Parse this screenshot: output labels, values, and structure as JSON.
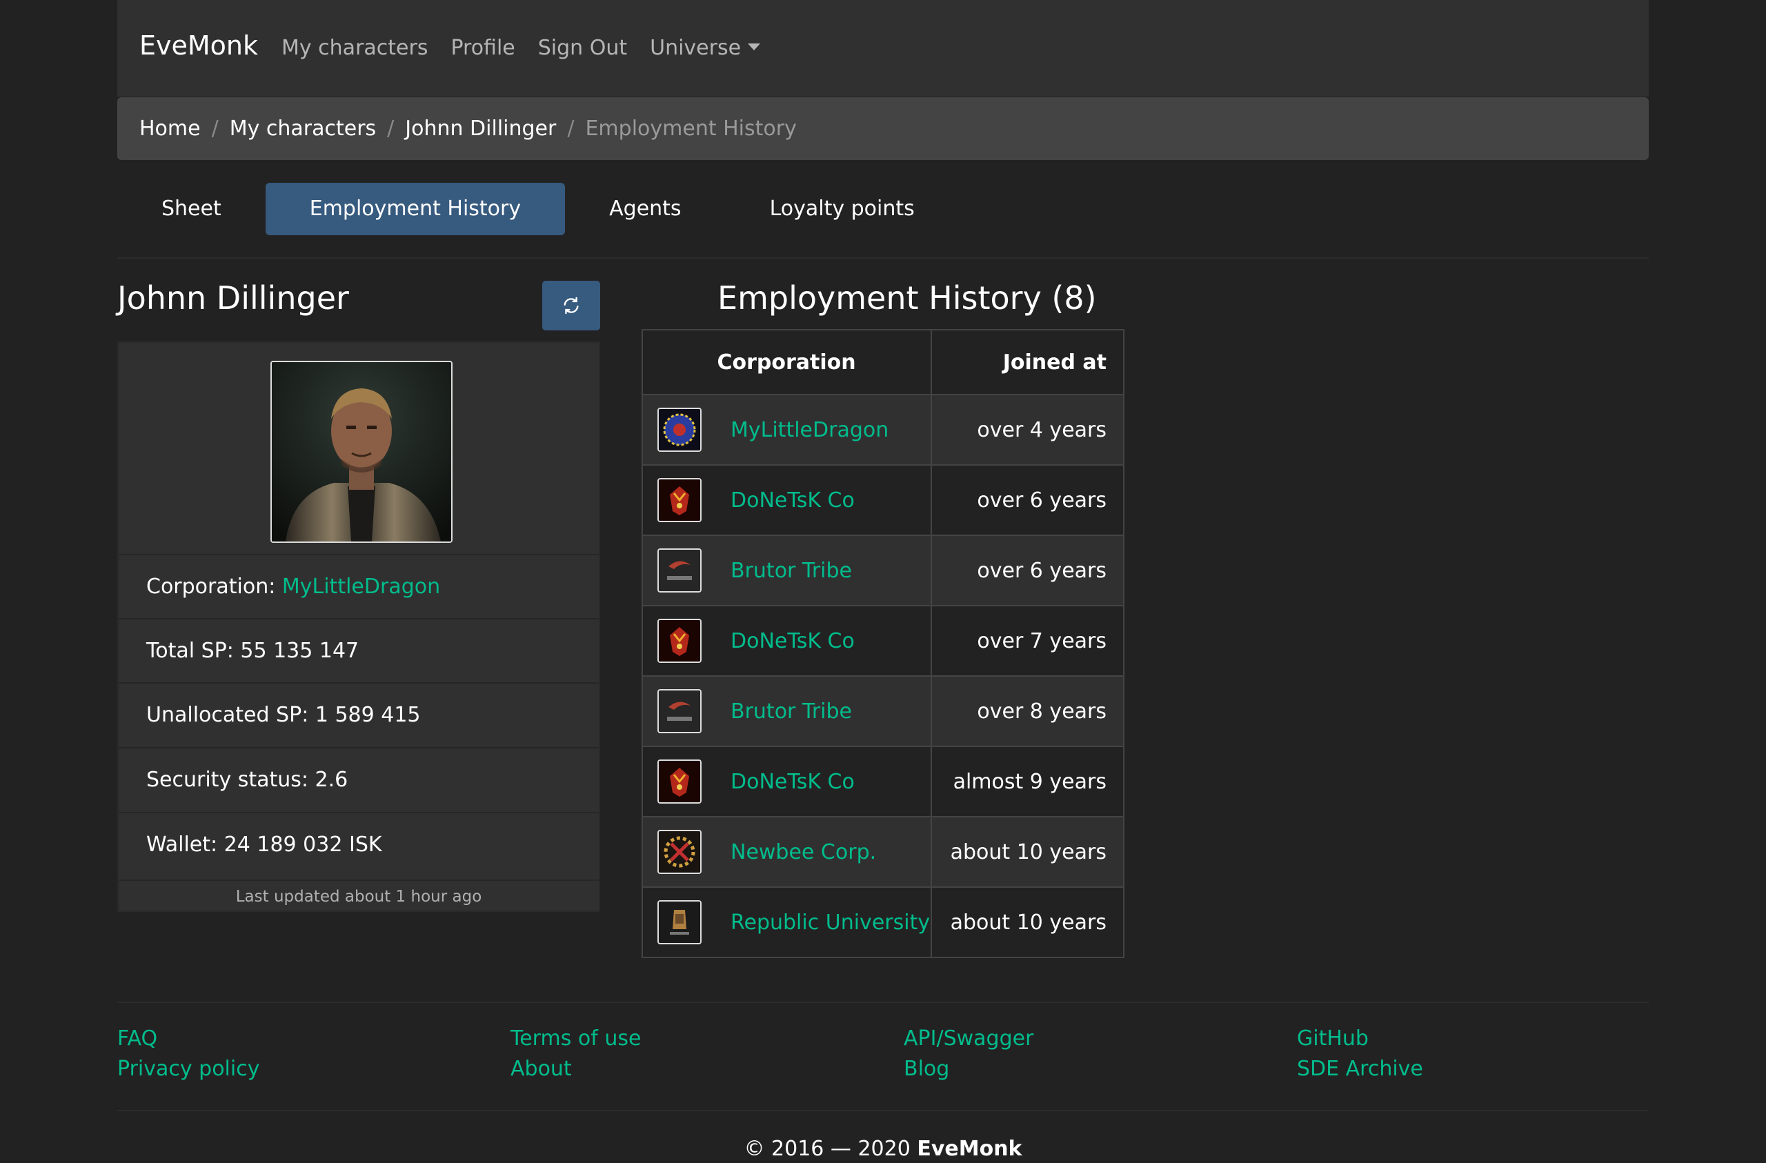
{
  "navbar": {
    "brand": "EveMonk",
    "links": [
      "My characters",
      "Profile",
      "Sign Out",
      "Universe"
    ]
  },
  "breadcrumb": [
    "Home",
    "My characters",
    "Johnn Dillinger",
    "Employment History"
  ],
  "tabs": [
    "Sheet",
    "Employment History",
    "Agents",
    "Loyalty points"
  ],
  "character": {
    "name": "Johnn Dillinger",
    "corporation_label": "Corporation: ",
    "corporation": "MyLittleDragon",
    "total_sp": "Total SP: 55 135 147",
    "unallocated_sp": "Unallocated SP: 1 589 415",
    "security_status": "Security status: 2.6",
    "wallet": "Wallet: 24 189 032 ISK",
    "last_updated": "Last updated about 1 hour ago"
  },
  "employment": {
    "title": "Employment History (8)",
    "columns": [
      "Corporation",
      "Joined at"
    ],
    "rows": [
      {
        "corporation": "MyLittleDragon",
        "joined": "over 4 years",
        "icon": "mylittledragon-logo-icon"
      },
      {
        "corporation": "DoNeTsK Co",
        "joined": "over 6 years",
        "icon": "donetsk-logo-icon"
      },
      {
        "corporation": "Brutor Tribe",
        "joined": "over 6 years",
        "icon": "brutor-logo-icon"
      },
      {
        "corporation": "DoNeTsK Co",
        "joined": "over 7 years",
        "icon": "donetsk-logo-icon"
      },
      {
        "corporation": "Brutor Tribe",
        "joined": "over 8 years",
        "icon": "brutor-logo-icon"
      },
      {
        "corporation": "DoNeTsK Co",
        "joined": "almost 9 years",
        "icon": "donetsk-logo-icon"
      },
      {
        "corporation": "Newbee Corp.",
        "joined": "about 10 years",
        "icon": "newbee-logo-icon"
      },
      {
        "corporation": "Republic University",
        "joined": "about 10 years",
        "icon": "republic-university-logo-icon"
      }
    ]
  },
  "footer": {
    "col1": [
      "FAQ",
      "Privacy policy"
    ],
    "col2": [
      "Terms of use",
      "About"
    ],
    "col3": [
      "API/Swagger",
      "Blog"
    ],
    "col4": [
      "GitHub",
      "SDE Archive"
    ],
    "copyright_prefix": "© 2016 — 2020 ",
    "copyright_brand": "EveMonk"
  },
  "colors": {
    "background": "#222222",
    "navbar": "#303030",
    "accent_blue": "#375a7f",
    "link_green": "#00bc8c"
  }
}
